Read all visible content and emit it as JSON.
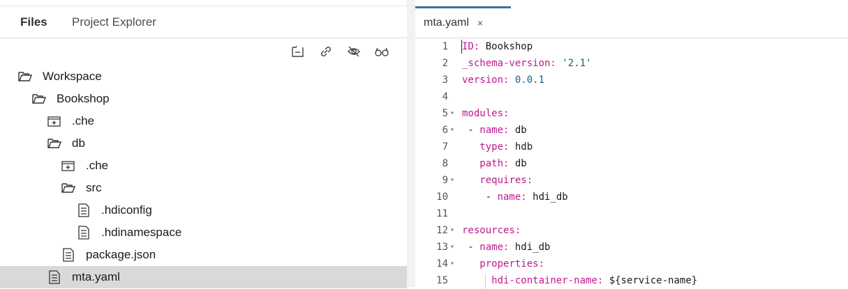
{
  "left_panel": {
    "tabs": [
      {
        "label": "Files",
        "active": true
      },
      {
        "label": "Project Explorer",
        "active": false
      }
    ],
    "toolbar": [
      "collapse-all-icon",
      "link-icon",
      "hide-icon",
      "glasses-icon"
    ],
    "tree": [
      {
        "label": "Workspace",
        "type": "folder-open",
        "depth": 0
      },
      {
        "label": "Bookshop",
        "type": "folder-open",
        "depth": 1
      },
      {
        "label": ".che",
        "type": "folder-closed",
        "depth": 2
      },
      {
        "label": "db",
        "type": "folder-open",
        "depth": 2
      },
      {
        "label": ".che",
        "type": "folder-closed",
        "depth": 3
      },
      {
        "label": "src",
        "type": "folder-open",
        "depth": 3
      },
      {
        "label": ".hdiconfig",
        "type": "file",
        "depth": 4
      },
      {
        "label": ".hdinamespace",
        "type": "file",
        "depth": 4
      },
      {
        "label": "package.json",
        "type": "file",
        "depth": 3
      },
      {
        "label": "mta.yaml",
        "type": "file",
        "depth": 2,
        "selected": true
      }
    ]
  },
  "editor": {
    "tab": {
      "label": "mta.yaml",
      "close": "×"
    },
    "lines": [
      {
        "n": "1",
        "fold": "",
        "key": "ID:",
        "val": " Bookshop",
        "vtype": "v",
        "indent": ""
      },
      {
        "n": "2",
        "fold": "",
        "key": "_schema-version:",
        "val": " '2.1'",
        "vtype": "s",
        "indent": ""
      },
      {
        "n": "3",
        "fold": "",
        "key": "version:",
        "val": " 0.0.1",
        "vtype": "n",
        "indent": ""
      },
      {
        "n": "4",
        "fold": "",
        "key": "",
        "val": "",
        "vtype": "v",
        "indent": ""
      },
      {
        "n": "5",
        "fold": "▾",
        "key": "modules:",
        "val": "",
        "vtype": "v",
        "indent": ""
      },
      {
        "n": "6",
        "fold": "▾",
        "key": "name:",
        "val": " db",
        "vtype": "v",
        "indent": " - "
      },
      {
        "n": "7",
        "fold": "",
        "key": "type:",
        "val": " hdb",
        "vtype": "v",
        "indent": "   "
      },
      {
        "n": "8",
        "fold": "",
        "key": "path:",
        "val": " db",
        "vtype": "v",
        "indent": "   "
      },
      {
        "n": "9",
        "fold": "▾",
        "key": "requires:",
        "val": "",
        "vtype": "v",
        "indent": "   "
      },
      {
        "n": "10",
        "fold": "",
        "key": "name:",
        "val": " hdi_db",
        "vtype": "v",
        "indent": "    - "
      },
      {
        "n": "11",
        "fold": "",
        "key": "",
        "val": "",
        "vtype": "v",
        "indent": ""
      },
      {
        "n": "12",
        "fold": "▾",
        "key": "resources:",
        "val": "",
        "vtype": "v",
        "indent": ""
      },
      {
        "n": "13",
        "fold": "▾",
        "key": "name:",
        "val": " hdi_db",
        "vtype": "v",
        "indent": " - "
      },
      {
        "n": "14",
        "fold": "▾",
        "key": "properties:",
        "val": "",
        "vtype": "v",
        "indent": "   "
      },
      {
        "n": "15",
        "fold": "",
        "key": "hdi-container-name:",
        "val": " ${service-name}",
        "vtype": "v",
        "indent": "     "
      }
    ]
  }
}
